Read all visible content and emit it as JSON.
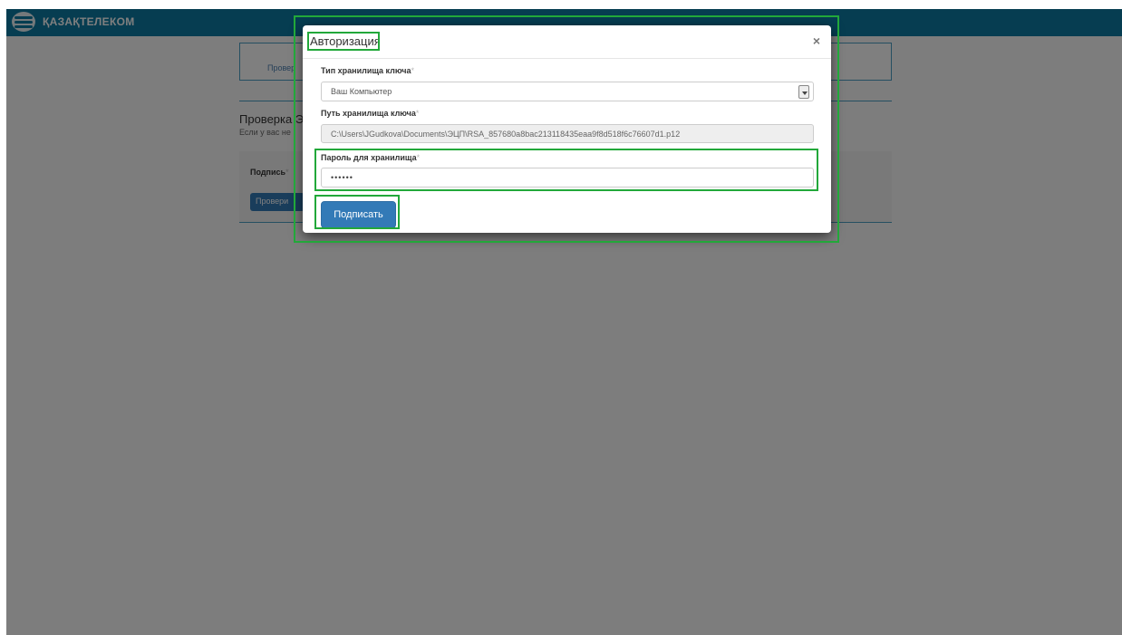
{
  "app": {
    "brand": "ҚАЗАҚТЕЛЕКОМ"
  },
  "background": {
    "panel_left": "Провер",
    "panel_right": "",
    "heading": "Проверка Э",
    "subtext": "Если у вас не",
    "box_label": "Подпись",
    "box_required": "*",
    "box_button": "Провери"
  },
  "modal": {
    "title": "Авторизация",
    "close": "×",
    "store_type_label": "Тип хранилища ключа",
    "store_type_value": "Ваш Компьютер",
    "store_path_label": "Путь хранилища ключа",
    "store_path_value": "C:\\Users\\JGudkova\\Documents\\ЭЦП\\RSA_857680a8bac213118435eaa9f8d518f6c76607d1.p12",
    "password_label": "Пароль для хранилища",
    "password_value": "••••••",
    "required_mark": "*",
    "sign_button": "Подписать"
  },
  "colors": {
    "header": "#0c7aa3",
    "primary_button": "#337ab7",
    "annotation": "#22a83a"
  }
}
